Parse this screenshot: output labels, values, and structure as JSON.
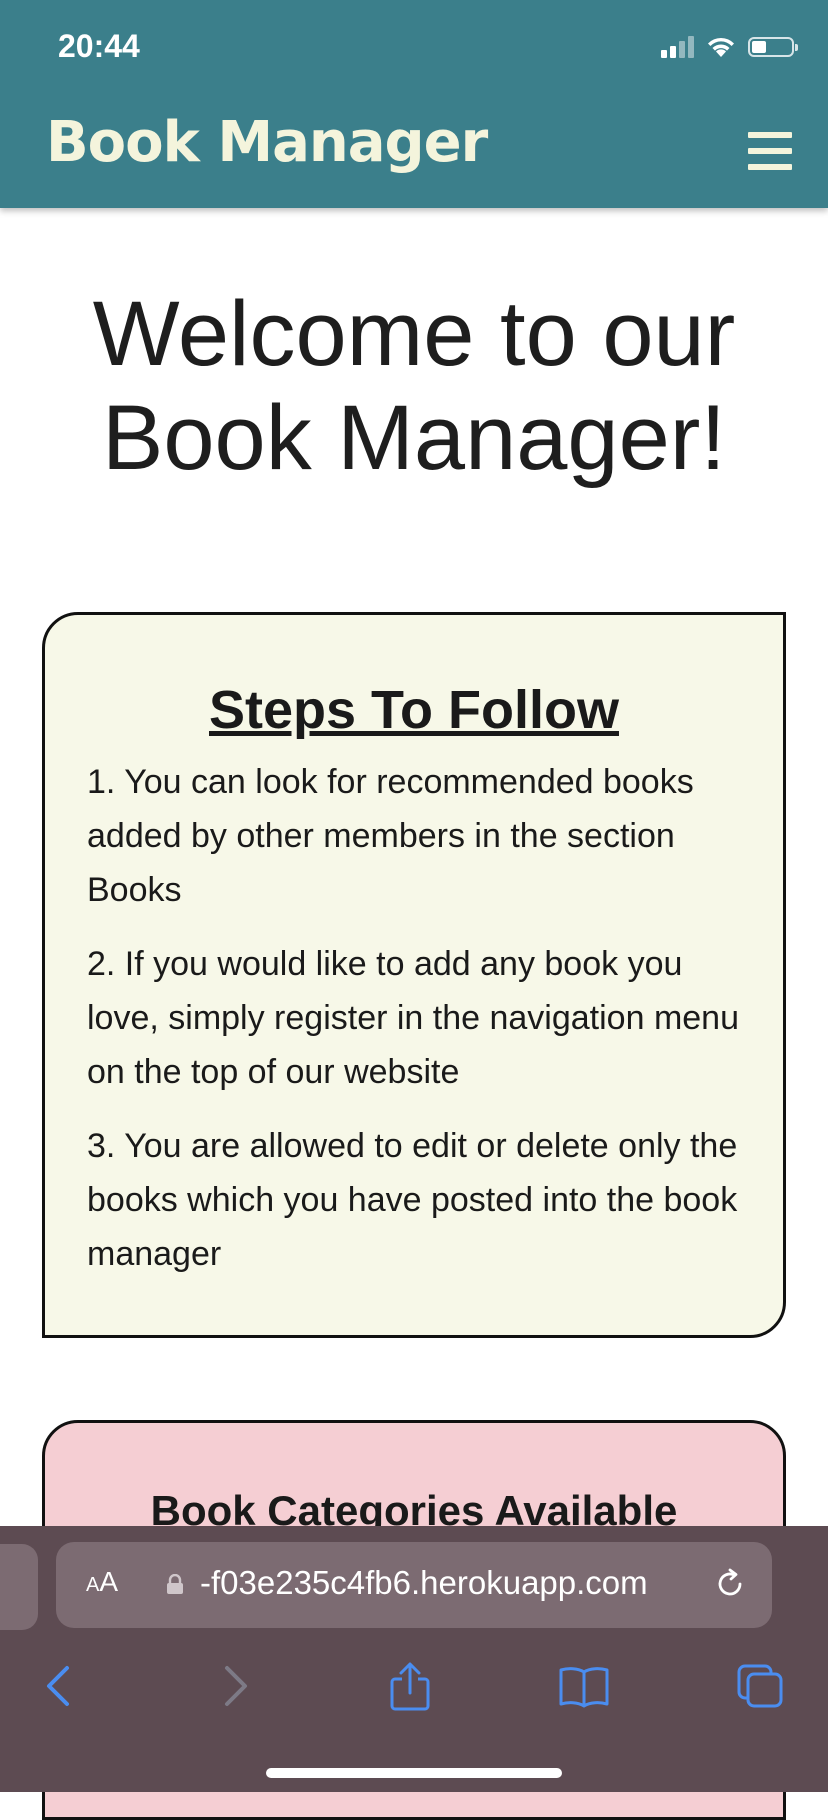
{
  "status_bar": {
    "time": "20:44"
  },
  "nav": {
    "brand": "Book Manager"
  },
  "hero": {
    "title": "Welcome to our Book Manager!"
  },
  "steps": {
    "title": "Steps To Follow",
    "items": [
      "1. You can look for recommended books added by other members in the section Books",
      "2. If you would like to add any book you love, simply register in the navigation menu on the top of our website",
      "3. You are allowed to edit or delete only the books which you have posted into the book manager"
    ]
  },
  "categories": {
    "title": "Book Categories Available"
  },
  "browser": {
    "text_size_label": "AA",
    "url": "-f03e235c4fb6.herokuapp.com"
  },
  "colors": {
    "nav_bg": "#3b7f8b",
    "brand_text": "#f4f4dc",
    "steps_bg": "#f7f8e8",
    "categories_bg": "#f5ced3",
    "browser_bar": "#5d4b52",
    "browser_accent": "#4a8df0"
  }
}
